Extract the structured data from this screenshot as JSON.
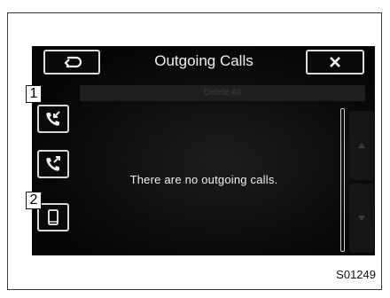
{
  "header": {
    "title": "Outgoing Calls",
    "back_icon": "back-arrow-icon",
    "close_icon": "close-icon"
  },
  "actions": {
    "delete_all": "Delete All"
  },
  "sidebar": {
    "items": [
      {
        "icon": "incoming-call-icon",
        "callout": "1"
      },
      {
        "icon": "outgoing-call-icon"
      },
      {
        "icon": "phone-device-icon",
        "callout": "2"
      }
    ]
  },
  "main": {
    "empty_message": "There are no outgoing calls."
  },
  "scroll": {
    "up_icon": "triangle-up-icon",
    "down_icon": "triangle-down-icon"
  },
  "figure_code": "S01249",
  "colors": {
    "screen_bg": "#050505",
    "text": "#f0f0f0",
    "border": "#dcdcdc"
  }
}
